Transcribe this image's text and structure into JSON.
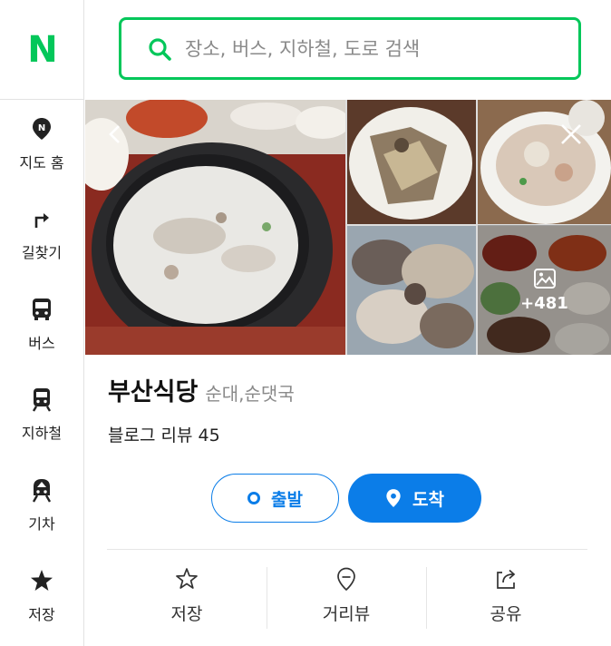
{
  "logo": "N",
  "search": {
    "placeholder": "장소, 버스, 지하철, 도로 검색"
  },
  "sidebar": {
    "items": [
      {
        "label": "지도 홈",
        "icon": "map-home-pin-icon"
      },
      {
        "label": "길찾기",
        "icon": "directions-arrow-icon"
      },
      {
        "label": "버스",
        "icon": "bus-icon"
      },
      {
        "label": "지하철",
        "icon": "subway-icon"
      },
      {
        "label": "기차",
        "icon": "train-icon"
      },
      {
        "label": "저장",
        "icon": "star-icon"
      }
    ]
  },
  "place": {
    "name": "부산식당",
    "category": "순대,순댓국",
    "review": "블로그 리뷰 45",
    "photo_more_count": "+481"
  },
  "buttons": {
    "start": "출발",
    "arrive": "도착"
  },
  "actions": [
    {
      "label": "저장",
      "icon": "star-outline-icon"
    },
    {
      "label": "거리뷰",
      "icon": "street-view-pin-icon"
    },
    {
      "label": "공유",
      "icon": "share-icon"
    }
  ],
  "colors": {
    "brand": "#03c75a",
    "accent": "#0b7de8"
  }
}
